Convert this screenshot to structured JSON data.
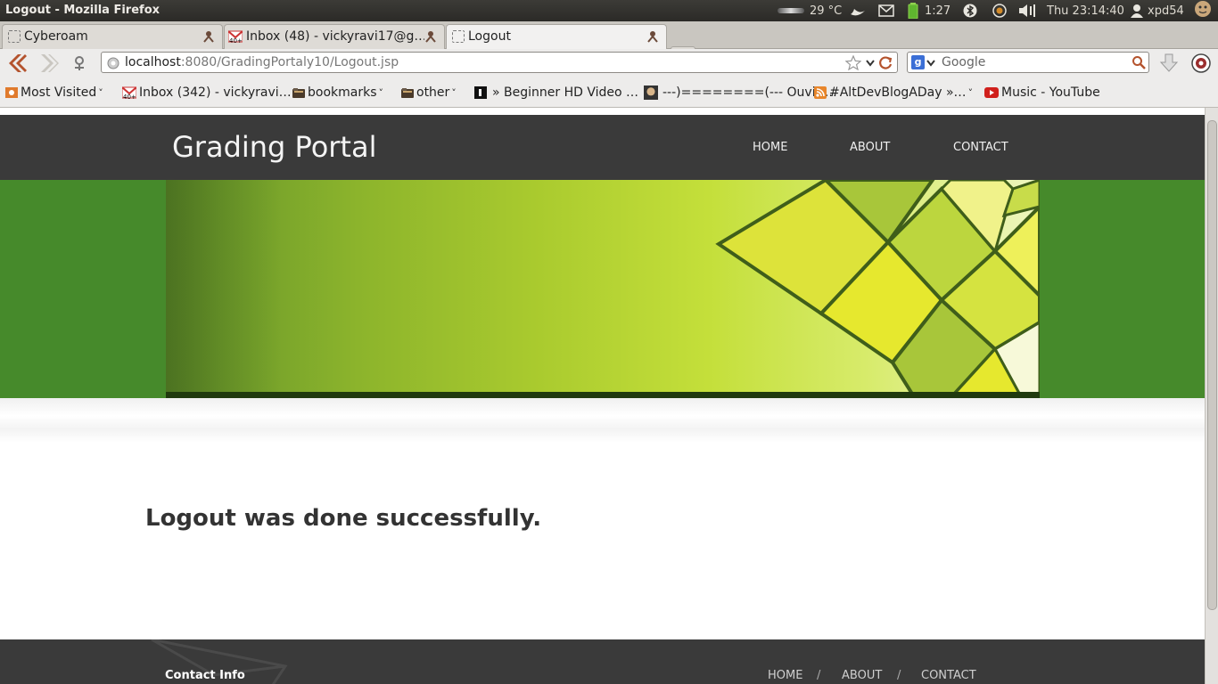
{
  "os_panel": {
    "window_title": "Logout - Mozilla Firefox",
    "weather": "29 °C",
    "battery": "1:27",
    "clock": "Thu 23:14:40",
    "user": "xpd54"
  },
  "tabs": [
    {
      "label": "Cyberoam",
      "icon": "blank-page-icon",
      "active": false
    },
    {
      "label": "Inbox (48) - vickyravi17@g…",
      "icon": "gmail-icon",
      "active": false
    },
    {
      "label": "Logout",
      "icon": "blank-page-icon",
      "active": true
    }
  ],
  "navbar": {
    "url_host": "localhost",
    "url_path": ":8080/GradingPortaly10/Logout.jsp",
    "search_placeholder": "Google"
  },
  "bookmarks": [
    {
      "label": "Most Visited",
      "icon": "most-visited-icon",
      "dropdown": true
    },
    {
      "label": "Inbox (342) - vickyravi…",
      "icon": "gmail-icon",
      "dropdown": false
    },
    {
      "label": "bookmarks",
      "icon": "folder-icon",
      "dropdown": true
    },
    {
      "label": "other",
      "icon": "folder-icon",
      "dropdown": true
    },
    {
      "label": "» Beginner HD Video …",
      "icon": "page-icon",
      "dropdown": false
    },
    {
      "label": "---)========(--- Ouvir …",
      "icon": "page-icon",
      "dropdown": false
    },
    {
      "label": "#AltDevBlogADay »…",
      "icon": "rss-icon",
      "dropdown": true
    },
    {
      "label": "Music - YouTube",
      "icon": "youtube-icon",
      "dropdown": false
    }
  ],
  "site": {
    "title": "Grading Portal",
    "nav": [
      "HOME",
      "ABOUT",
      "CONTACT"
    ],
    "message": "Logout was done successfully.",
    "footer": {
      "contact_heading": "Contact Info",
      "links": [
        "HOME",
        "ABOUT",
        "CONTACT"
      ],
      "separator": "/"
    }
  },
  "colors": {
    "header_bg": "#3a3a3a",
    "banner_band": "#468a2b",
    "banner_accent": "#e6e82e"
  }
}
